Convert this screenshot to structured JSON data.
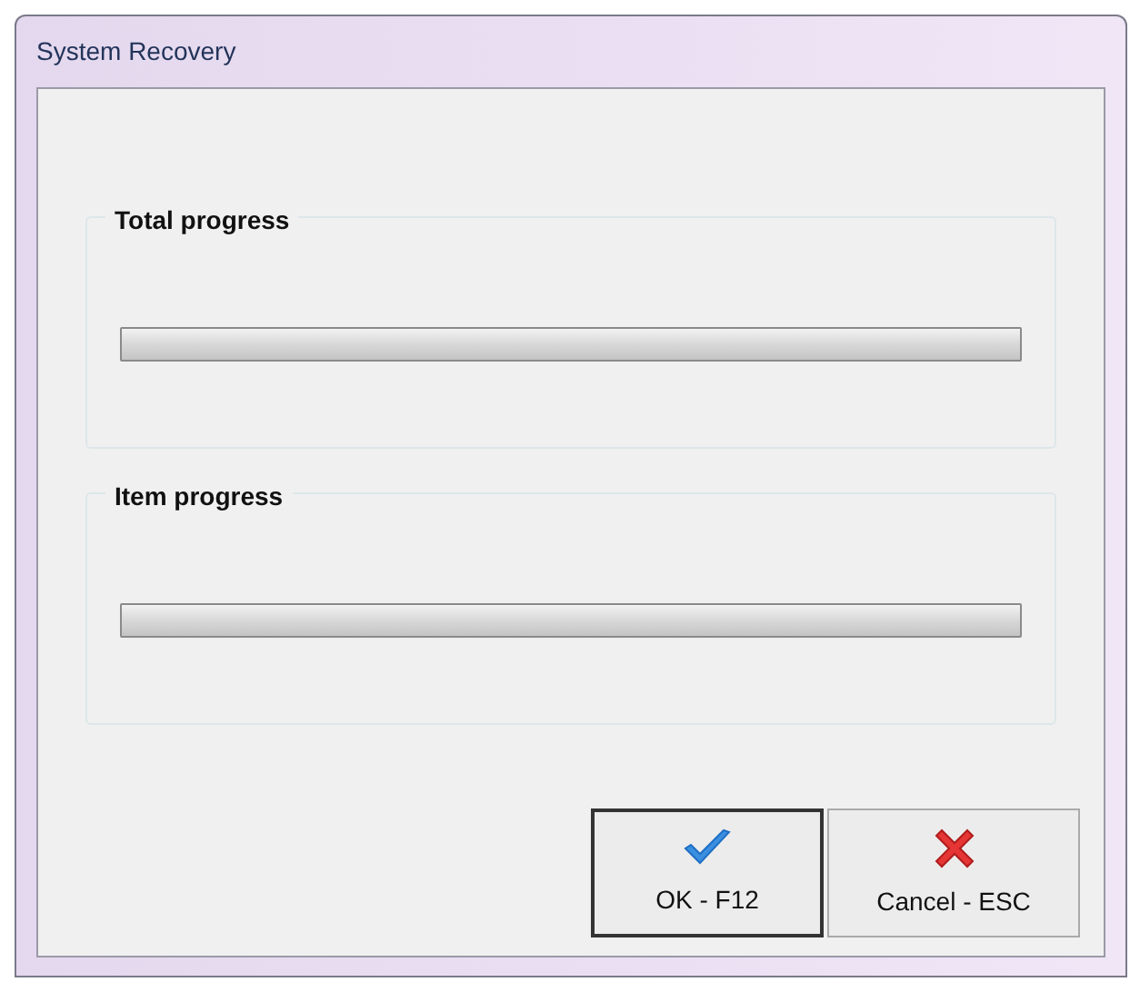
{
  "window": {
    "title": "System Recovery"
  },
  "groups": [
    {
      "title": "Total progress",
      "level": 0
    },
    {
      "title": "Item progress",
      "level": 0
    }
  ],
  "buttons": [
    {
      "label": "OK - F12",
      "kind": "ok",
      "default": true
    },
    {
      "label": "Cancel - ESC",
      "kind": "cancel",
      "default": false
    }
  ]
}
